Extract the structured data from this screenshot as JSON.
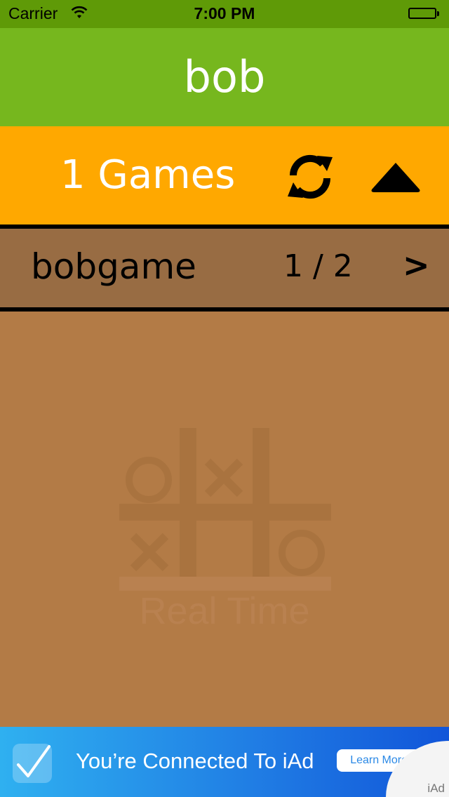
{
  "status_bar": {
    "carrier": "Carrier",
    "time": "7:00 PM"
  },
  "header": {
    "title": "bob"
  },
  "games_bar": {
    "count_label": "1 Games"
  },
  "games": [
    {
      "name": "bobgame",
      "progress": "1 / 2",
      "chevron": ">"
    }
  ],
  "watermark": {
    "text": "Real Time"
  },
  "ad": {
    "text": "You’re Connected To iAd",
    "learn_more": "Learn More",
    "badge": "iAd"
  },
  "colors": {
    "status_bar": "#5f9a07",
    "header": "#76b71e",
    "games_bar": "#ffa800",
    "game_row": "#986c43",
    "background": "#b37b46"
  }
}
